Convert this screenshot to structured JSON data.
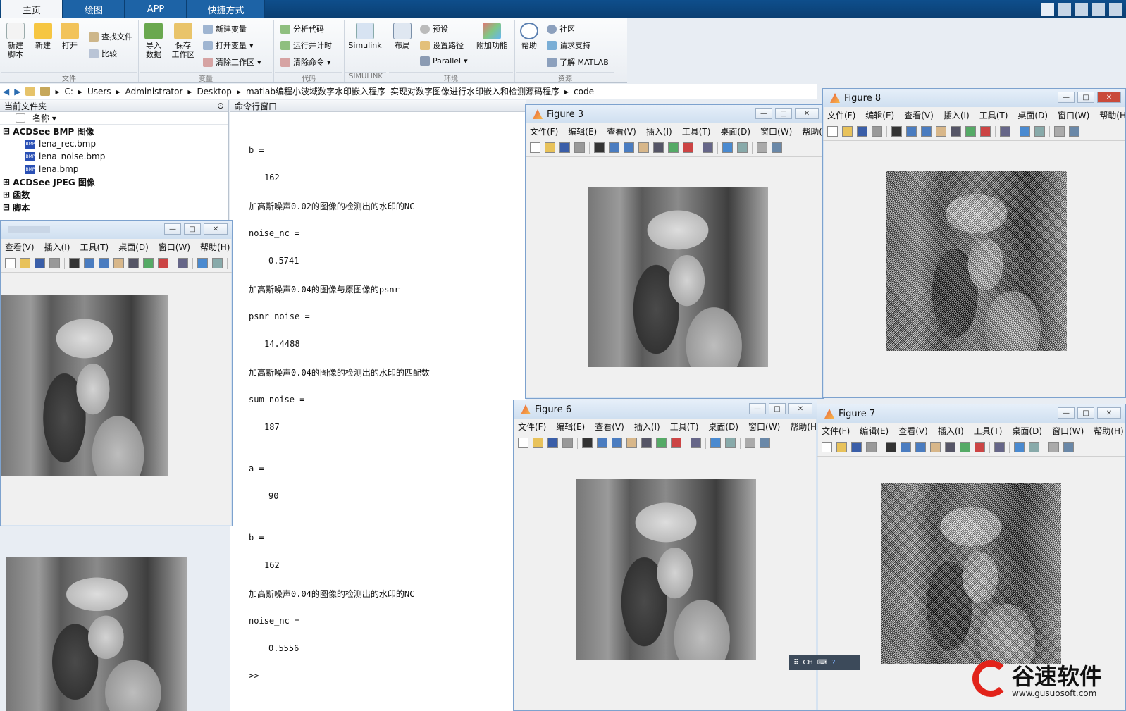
{
  "tabs": [
    "主页",
    "绘图",
    "APP",
    "快捷方式"
  ],
  "ribbon": {
    "new_script": "新建\n脚本",
    "new": "新建",
    "open": "打开",
    "find_files": "查找文件",
    "compare": "比较",
    "import": "导入\n数据",
    "save_ws": "保存\n工作区",
    "new_var": "新建变量",
    "open_var": "打开变量",
    "clear_ws": "清除工作区",
    "analyze": "分析代码",
    "run_time": "运行并计时",
    "clear_cmd": "清除命令",
    "simulink": "Simulink",
    "layout": "布局",
    "prefs": "预设",
    "set_path": "设置路径",
    "parallel": "Parallel",
    "addons": "附加功能",
    "help": "帮助",
    "community": "社区",
    "support": "请求支持",
    "learn": "了解 MATLAB",
    "groups": {
      "file": "文件",
      "var": "变量",
      "code": "代码",
      "sim": "SIMULINK",
      "env": "环境",
      "res": "资源"
    }
  },
  "address": [
    "C:",
    "Users",
    "Administrator",
    "Desktop",
    "matlab编程小波域数字水印嵌入程序",
    "实现对数字图像进行水印嵌入和检测源码程序",
    "code"
  ],
  "file_panel": {
    "title": "当前文件夹",
    "col": "名称",
    "groups": [
      {
        "name": "ACDSee BMP 图像",
        "files": [
          "lena_rec.bmp",
          "lena_noise.bmp",
          "lena.bmp"
        ]
      },
      {
        "name": "ACDSee JPEG 图像"
      },
      {
        "name": "函数"
      },
      {
        "name": "脚本"
      }
    ]
  },
  "cmd": {
    "title": "命令行窗口",
    "lines": [
      "b =",
      "162",
      "加高斯噪声0.02的图像的检测出的水印的NC",
      "noise_nc =",
      "0.5741",
      "加高斯噪声0.04的图像与原图像的psnr",
      "psnr_noise =",
      "14.4488",
      "加高斯噪声0.04的图像的检测出的水印的匹配数",
      "sum_noise =",
      "187",
      "a =",
      "90",
      "b =",
      "162",
      "加高斯噪声0.04的图像的检测出的水印的NC",
      "noise_nc =",
      "0.5556",
      ">>"
    ]
  },
  "figure_menu_full": [
    "文件(F)",
    "编辑(E)",
    "查看(V)",
    "插入(I)",
    "工具(T)",
    "桌面(D)",
    "窗口(W)",
    "帮助(H)"
  ],
  "figure_menu_partial": [
    "查看(V)",
    "插入(I)",
    "工具(T)",
    "桌面(D)",
    "窗口(W)",
    "帮助(H)"
  ],
  "figures": {
    "f3": "Figure 3",
    "f8": "Figure 8",
    "f6": "Figure 6",
    "f7": "Figure 7"
  },
  "ime": "CH",
  "watermark": {
    "brand": "谷速软件",
    "url": "www.gusuosoft.com",
    "color": "#e2231a"
  }
}
